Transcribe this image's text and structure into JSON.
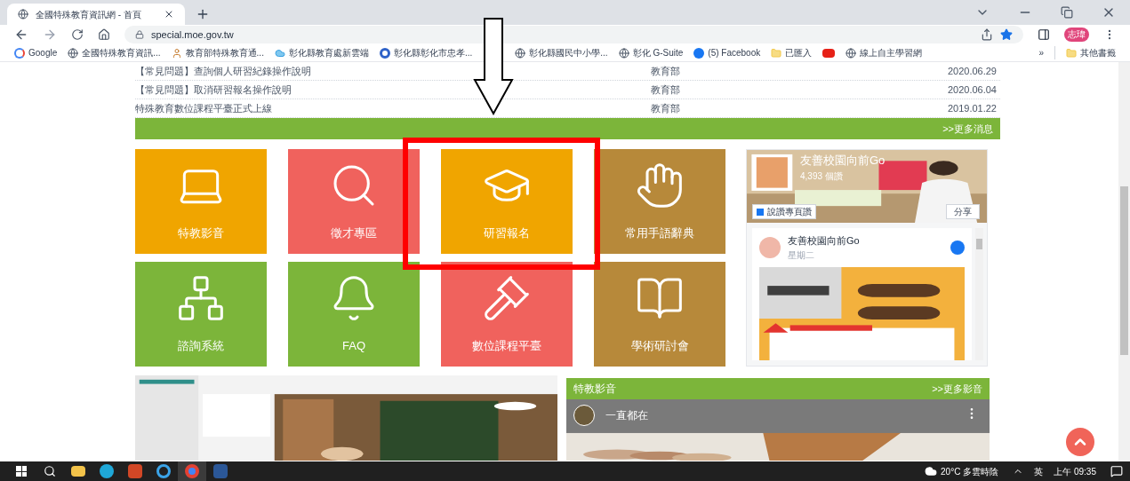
{
  "browser": {
    "tabs": [
      {
        "title": "全國特殊教育資訊網 - 首頁",
        "selected": true
      }
    ],
    "url": "special.moe.gov.tw",
    "profile": "志瑋",
    "bookmarks": [
      {
        "kind": "google",
        "label": "Google"
      },
      {
        "kind": "globe",
        "label": "全國特殊教育資訊..."
      },
      {
        "kind": "person",
        "label": "教育部特殊教育通..."
      },
      {
        "kind": "cloud",
        "label": "彰化縣教育處新雲端"
      },
      {
        "kind": "ring",
        "label": "彰化縣彰化市忠孝..."
      },
      {
        "kind": "globe",
        "label": "彰化縣國民中小學..."
      },
      {
        "kind": "globe",
        "label": "彰化 G-Suite"
      },
      {
        "kind": "facebook",
        "label": "(5) Facebook"
      },
      {
        "kind": "folder",
        "label": "已匯入"
      },
      {
        "kind": "youtube"
      },
      {
        "kind": "globe",
        "label": "線上自主學習網"
      }
    ],
    "more_bookmarks": "»",
    "other_bookmarks": "其他書籤"
  },
  "news": [
    {
      "title": "【常見問題】查詢個人研習紀錄操作說明",
      "source": "教育部",
      "date": "2020.06.29"
    },
    {
      "title": "【常見問題】取消研習報名操作說明",
      "source": "教育部",
      "date": "2020.06.04"
    },
    {
      "title": "特殊教育數位課程平臺正式上線",
      "source": "教育部",
      "date": "2019.01.22"
    }
  ],
  "more_news": ">>更多消息",
  "tiles": [
    {
      "kind": "laptop",
      "label": "特教影音",
      "color": "#f0a500"
    },
    {
      "kind": "search",
      "label": "徵才專區",
      "color": "#f0625d"
    },
    {
      "kind": "cap",
      "label": "研習報名",
      "color": "#f0a500"
    },
    {
      "kind": "hand",
      "label": "常用手語辭典",
      "color": "#b7893a"
    },
    {
      "kind": "network",
      "label": "諮詢系統",
      "color": "#7cb53a"
    },
    {
      "kind": "bell",
      "label": "FAQ",
      "color": "#7cb53a"
    },
    {
      "kind": "gavel",
      "label": "數位課程平臺",
      "color": "#f0625d"
    },
    {
      "kind": "book",
      "label": "學術研討會",
      "color": "#b7893a"
    }
  ],
  "facebook": {
    "page_name": "友善校園向前Go",
    "likes": "4,393 個讚",
    "like_button": "說讚專頁讚",
    "share_button": "分享",
    "post_author": "友善校園向前Go",
    "post_time": "星期二"
  },
  "video_section": {
    "title": "特教影音",
    "more": ">>更多影音",
    "video_title": "一直都在"
  },
  "annotations": {
    "pointer_arrow": true,
    "highlight_frame": true
  },
  "taskbar": {
    "apps": [
      {
        "kind": "windows"
      },
      {
        "kind": "search"
      },
      {
        "kind": "folder"
      },
      {
        "kind": "edge"
      },
      {
        "kind": "powerpoint"
      },
      {
        "kind": "ie"
      },
      {
        "kind": "chrome",
        "selected": true
      },
      {
        "kind": "word"
      }
    ],
    "weather": "20°C 多雲時陰",
    "ime": "英",
    "time": "上午 09:35"
  }
}
